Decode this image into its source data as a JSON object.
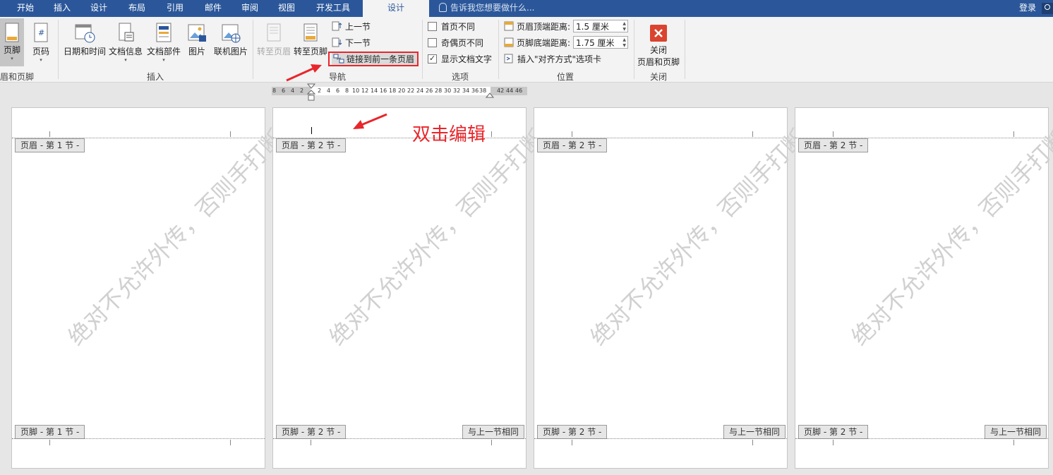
{
  "tabs": {
    "t0": "开始",
    "t1": "插入",
    "t2": "设计",
    "t3": "布局",
    "t4": "引用",
    "t5": "邮件",
    "t6": "审阅",
    "t7": "视图",
    "t8": "开发工具",
    "t9": "设计"
  },
  "tell_me": "告诉我您想要做什么...",
  "login": "登录",
  "ribbon": {
    "hf_group": {
      "footer": "页脚",
      "page_number": "页码",
      "label": "眉和页脚"
    },
    "insert_group": {
      "date_time": "日期和时间",
      "doc_info": "文档信息",
      "doc_parts": "文档部件",
      "picture": "图片",
      "online_picture": "联机图片",
      "label": "插入"
    },
    "nav_group": {
      "goto_header": "转至页眉",
      "goto_footer": "转至页脚",
      "prev_section": "上一节",
      "next_section": "下一节",
      "link_to_previous": "链接到前一条页眉",
      "label": "导航"
    },
    "options_group": {
      "different_first": "首页不同",
      "different_odd_even": "奇偶页不同",
      "show_doc_text": "显示文档文字",
      "label": "选项"
    },
    "position_group": {
      "header_top_label": "页眉顶端距离:",
      "header_top_value": "1.5 厘米",
      "footer_bottom_label": "页脚底端距离:",
      "footer_bottom_value": "1.75 厘米",
      "insert_align_tab": "插入\"对齐方式\"选项卡",
      "label": "位置"
    },
    "close_group": {
      "close_line1": "关闭",
      "close_line2": "页眉和页脚",
      "label": "关闭"
    }
  },
  "ruler": {
    "left": [
      "8",
      "6",
      "4",
      "2"
    ],
    "right": [
      "2",
      "4",
      "6",
      "8",
      "10",
      "12",
      "14",
      "16",
      "18",
      "20",
      "22",
      "24",
      "26",
      "28",
      "30",
      "32",
      "34",
      "36",
      "38"
    ],
    "tail": [
      "42",
      "44",
      "46"
    ]
  },
  "pages": {
    "p1": {
      "header": "页眉 - 第 1 节 -",
      "footer": "页脚 - 第 1 节 -",
      "same": ""
    },
    "p2": {
      "header": "页眉 - 第 2 节 -",
      "footer": "页脚 - 第 2 节 -",
      "same": "与上一节相同"
    },
    "p3": {
      "header": "页眉 - 第 2 节 -",
      "footer": "页脚 - 第 2 节 -",
      "same": "与上一节相同"
    },
    "p4": {
      "header": "页眉 - 第 2 节 -",
      "footer": "页脚 - 第 2 节 -",
      "same": "与上一节相同"
    }
  },
  "watermark": "绝对不允许外传，否则手打断",
  "annotation": "双击编辑",
  "colors": {
    "tabbar": "#2b579a",
    "annotation": "#e8262b"
  }
}
